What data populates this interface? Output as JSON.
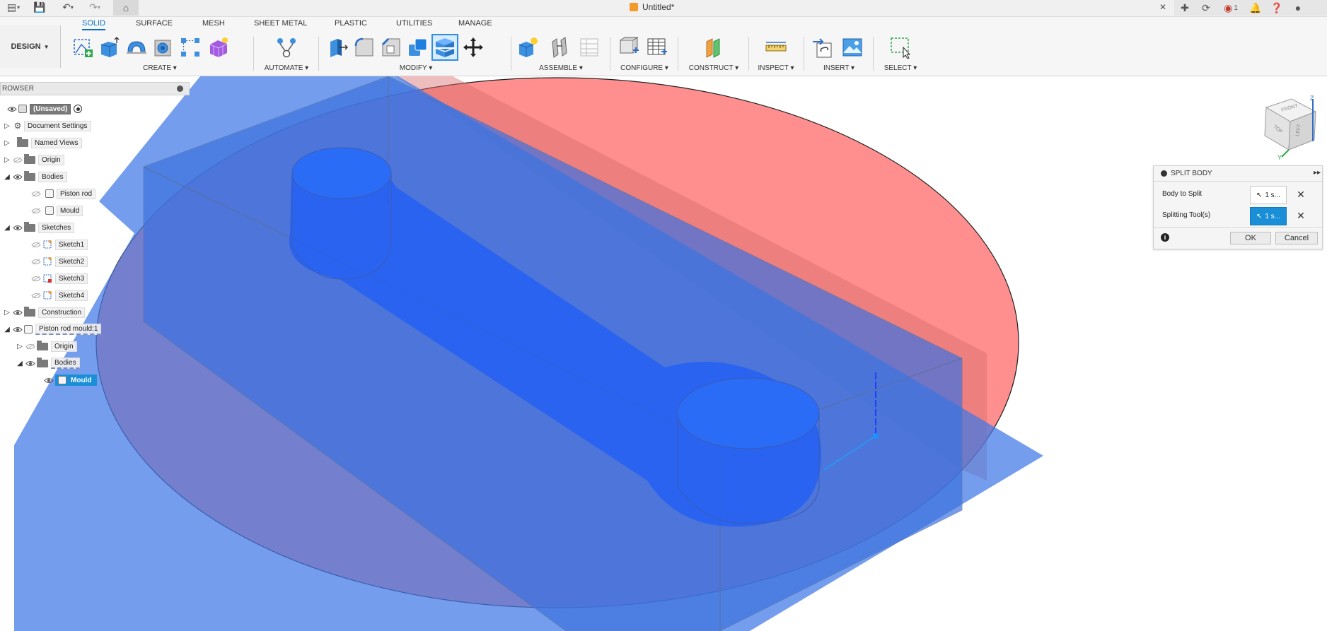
{
  "titlebar": {
    "doc_title": "Untitled*",
    "notification_count": "1"
  },
  "workspace": {
    "label": "DESIGN"
  },
  "ribbon": {
    "tabs": [
      "SOLID",
      "SURFACE",
      "MESH",
      "SHEET METAL",
      "PLASTIC",
      "UTILITIES",
      "MANAGE"
    ],
    "active_tab": "SOLID",
    "groups": {
      "create": "CREATE",
      "automate": "AUTOMATE",
      "modify": "MODIFY",
      "assemble": "ASSEMBLE",
      "configure": "CONFIGURE",
      "construct": "CONSTRUCT",
      "inspect": "INSPECT",
      "insert": "INSERT",
      "select": "SELECT"
    }
  },
  "browser": {
    "title": "ROWSER",
    "items": [
      {
        "label": "(Unsaved)"
      },
      {
        "label": "Document Settings"
      },
      {
        "label": "Named Views"
      },
      {
        "label": "Origin"
      },
      {
        "label": "Bodies"
      },
      {
        "label": "Piston rod"
      },
      {
        "label": "Mould"
      },
      {
        "label": "Sketches"
      },
      {
        "label": "Sketch1"
      },
      {
        "label": "Sketch2"
      },
      {
        "label": "Sketch3"
      },
      {
        "label": "Sketch4"
      },
      {
        "label": "Construction"
      },
      {
        "label": "Piston rod mould:1"
      },
      {
        "label": "Origin"
      },
      {
        "label": "Bodies"
      },
      {
        "label": "Mould"
      }
    ]
  },
  "viewcube": {
    "faces": [
      "FRONT",
      "TOP",
      "LEFT"
    ],
    "axes": [
      "Z",
      "Y"
    ]
  },
  "split_body": {
    "title": "SPLIT BODY",
    "body_to_split_label": "Body to Split",
    "body_to_split_value": "1 s...",
    "splitting_tools_label": "Splitting Tool(s)",
    "splitting_tools_value": "1 s...",
    "ok_label": "OK",
    "cancel_label": "Cancel"
  },
  "colors": {
    "accent": "#0a6fc2",
    "selected": "#1a8fd8",
    "plane_red": "#ff7070",
    "body_blue": "#2f6bff"
  }
}
